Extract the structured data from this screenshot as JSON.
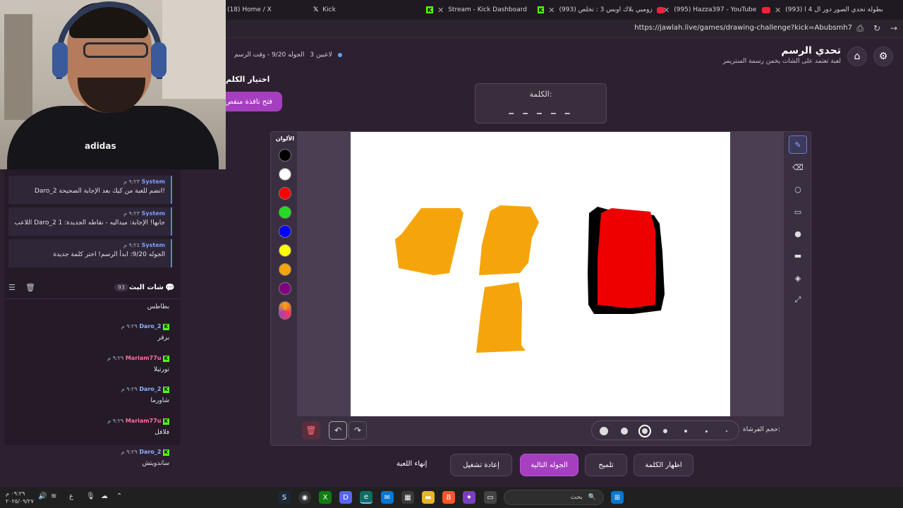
{
  "browser": {
    "tabs": [
      {
        "label": "(18) Home / X",
        "icon": "x-icon"
      },
      {
        "label": "Kick",
        "icon": "x-icon"
      },
      {
        "label": "Stream - Kick Dashboard",
        "icon": "kick-icon"
      },
      {
        "label": "(993) زومبي بلاك اوبس 3 : تخلص",
        "icon": "youtube-icon"
      },
      {
        "label": "(995) Hazza397 - YouTube",
        "icon": "youtube-icon"
      },
      {
        "label": "(993) بطولة تحدي الصور دور ال 4 ا",
        "icon": "youtube-icon"
      }
    ],
    "url": "https://jawlah.live/games/drawing-challenge?kick=Abubsmh7"
  },
  "header": {
    "title": "تحدي الرسم",
    "subtitle": "لعبة تعتمد على الشات يخمن رسمة الستريمر",
    "players": "3 لاعبين",
    "round_info": "الجوله 9/20 - وقت الرسم"
  },
  "word_choice": {
    "title": "اختيار الكلم",
    "button": "فتح نافذة منفص"
  },
  "word_box": {
    "label": "الكلمة:",
    "blanks": "_ _ _ _ _"
  },
  "system_messages": [
    {
      "author": "System",
      "time": "٩:٢٣ م",
      "text": "Daro_2 انضم للعبة من كيك بعد الإجابة الصحيحة!"
    },
    {
      "author": "System",
      "time": "٩:٢٣ م",
      "text": "اللاعب Daro_2 جابها! الإجابة: ميداليه - نقاطه الجديدة: 1"
    },
    {
      "author": "System",
      "time": "٩:٢٤ م",
      "text": "الجوله 9/20: ابدأ الرسم! اختر كلمة جديدة"
    }
  ],
  "chat": {
    "title": "شات البث",
    "count": "93",
    "first_text": "بطاطس",
    "messages": [
      {
        "author": "Daro_2",
        "time": "٩:٢٩ م",
        "text": "برقر",
        "color": "#8ab4ff"
      },
      {
        "author": "Mariam77u",
        "time": "٩:٢٩ م",
        "text": "تورتيلا",
        "color": "#ff6fa0"
      },
      {
        "author": "Daro_2",
        "time": "٩:٢٩ م",
        "text": "شاورما",
        "color": "#8ab4ff"
      },
      {
        "author": "Mariam77u",
        "time": "٩:٢٩ م",
        "text": "فلافل",
        "color": "#ff6fa0"
      },
      {
        "author": "Daro_2",
        "time": "٩:٢٩ م",
        "text": "ساندويتش",
        "color": "#8ab4ff"
      }
    ]
  },
  "palette": {
    "label": "الألوان",
    "colors": [
      "#000000",
      "#ffffff",
      "#ff0000",
      "#22dd22",
      "#0000ff",
      "#ffff00",
      "#f5a50b",
      "#800080"
    ]
  },
  "tools": [
    "pencil-icon",
    "eraser-icon",
    "circle-icon",
    "rectangle-icon",
    "filled-circle-icon",
    "filled-rectangle-icon",
    "fill-icon",
    "resize-icon"
  ],
  "brush": {
    "label": "حجم الفرشاة:",
    "selected_index": 2
  },
  "game_buttons": {
    "show_word": "اظهار الكلمة",
    "hint": "تلميح",
    "next_round": "الجوله التالية",
    "restart": "إعادة تشغيل",
    "end_game": "إنهاء اللعبة"
  },
  "taskbar": {
    "search_placeholder": "بحث",
    "time": "٠٩:٢٩ م",
    "date": "٢٠٢٥/٠٩/٢٧",
    "lang": "ع"
  },
  "colors": {
    "accent": "#a53fc0",
    "background": "#2d2131",
    "drawing_orange": "#f5a50b",
    "drawing_red": "#ee0000"
  }
}
